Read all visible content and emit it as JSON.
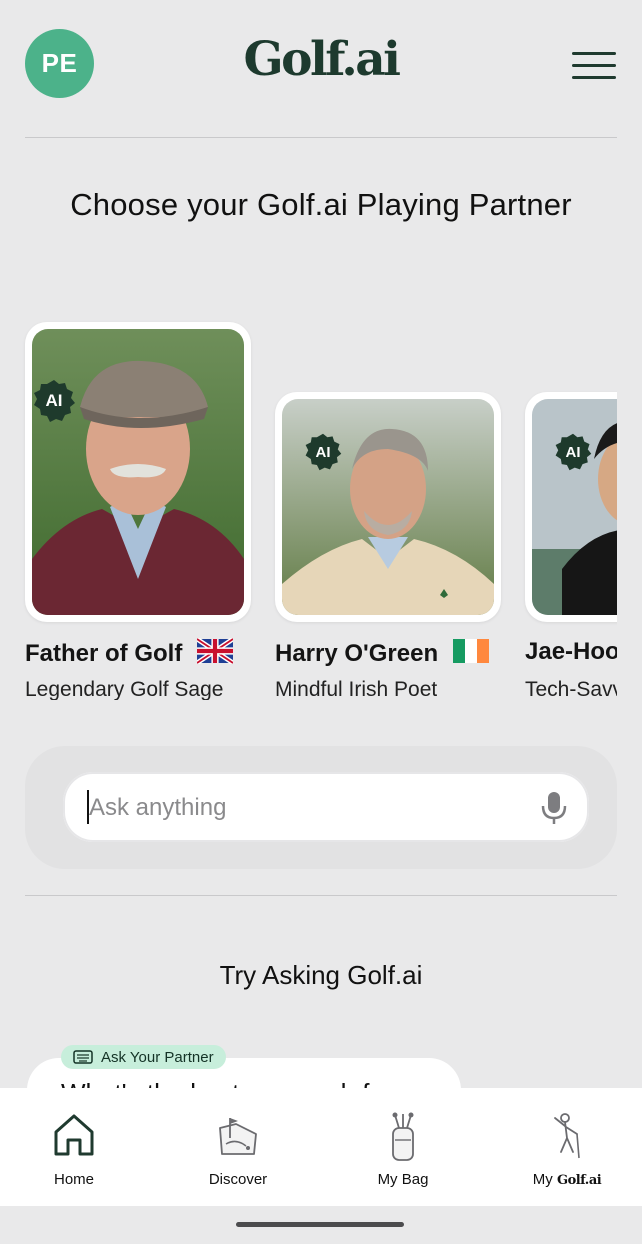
{
  "header": {
    "avatar_initials": "PE",
    "logo_text": "Golf.ai",
    "menu_icon": "hamburger-menu-icon"
  },
  "main": {
    "title": "Choose your Golf.ai Playing Partner",
    "partners": [
      {
        "name": "Father of Golf",
        "flag": "uk-flag",
        "subtitle": "Legendary Golf Sage",
        "badge": "AI"
      },
      {
        "name": "Harry O'Green",
        "flag": "ireland-flag",
        "subtitle": "Mindful Irish Poet",
        "badge": "AI"
      },
      {
        "name": "Jae-Hoo",
        "subtitle": "Tech-Savv",
        "badge": "AI"
      }
    ]
  },
  "search": {
    "placeholder": "Ask anything",
    "mic_icon": "microphone-icon"
  },
  "suggestions": {
    "title": "Try Asking Golf.ai",
    "tag": "Ask Your Partner",
    "text": "What's the best approach fo"
  },
  "nav": {
    "items": [
      {
        "label": "Home",
        "icon": "home-icon"
      },
      {
        "label": "Discover",
        "icon": "course-map-icon"
      },
      {
        "label": "My Bag",
        "icon": "golf-bag-icon"
      },
      {
        "label_prefix": "My ",
        "label_brand": "Golf.ai",
        "icon": "golfer-icon"
      }
    ]
  },
  "colors": {
    "brand_green": "#1d3a2e",
    "avatar_green": "#4cb28a",
    "tag_mint": "#c7eedb",
    "background": "#e9e9ea"
  }
}
